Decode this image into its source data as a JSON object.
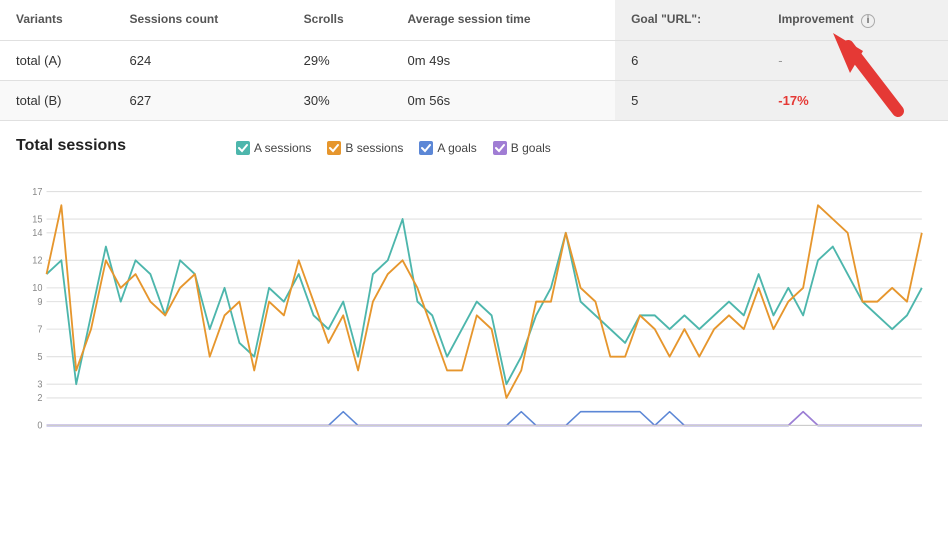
{
  "table": {
    "headers": [
      "Variants",
      "Sessions count",
      "Scrolls",
      "Average session time",
      "Goal \"URL\":",
      "Improvement"
    ],
    "rows": [
      {
        "variant": "total (A)",
        "sessions": "624",
        "scrolls": "29%",
        "avg_time": "0m 49s",
        "goal": "6",
        "improvement": "-",
        "improvement_type": "dash"
      },
      {
        "variant": "total (B)",
        "sessions": "627",
        "scrolls": "30%",
        "avg_time": "0m 56s",
        "goal": "5",
        "improvement": "-17%",
        "improvement_type": "negative"
      }
    ]
  },
  "chart": {
    "title": "Total sessions",
    "legend": [
      {
        "label": "A sessions",
        "color": "#4db6ac",
        "type": "check"
      },
      {
        "label": "B sessions",
        "color": "#e6962d",
        "type": "check"
      },
      {
        "label": "A goals",
        "color": "#5c87d6",
        "type": "check"
      },
      {
        "label": "B goals",
        "color": "#a07dd4",
        "type": "check"
      }
    ],
    "yMax": 17,
    "yLabels": [
      0,
      2,
      3,
      5,
      7,
      9,
      10,
      12,
      14,
      15,
      17
    ]
  }
}
